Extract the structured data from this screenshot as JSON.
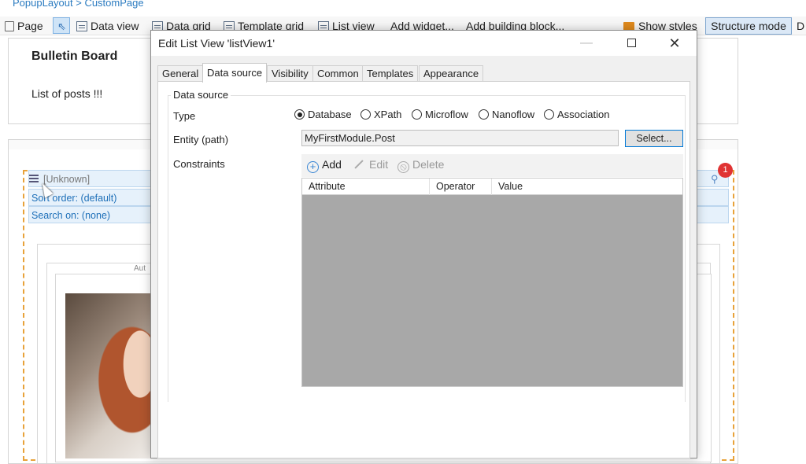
{
  "breadcrumb": {
    "text": "PopupLayout  >  CustomPage"
  },
  "toolbar": {
    "page": "Page",
    "data_view": "Data view",
    "data_grid": "Data grid",
    "template_grid": "Template grid",
    "list_view": "List view",
    "add_widget": "Add widget...",
    "add_building_block": "Add building block...",
    "show_styles": "Show styles",
    "structure_mode": "Structure mode",
    "overflow": "D"
  },
  "canvas": {
    "bulletin_title": "Bulletin Board",
    "list_of_posts": "List of posts !!!",
    "listview_unknown": "[Unknown]",
    "sort_order": "Sort order: (default)",
    "search_on": "Search on: (none)",
    "auto_label": "Aut",
    "badge_count": "1"
  },
  "dialog": {
    "title": "Edit List View 'listView1'",
    "tabs": [
      "General",
      "Data source",
      "Visibility",
      "Common",
      "Templates",
      "Appearance"
    ],
    "active_tab": "Data source",
    "group_label": "Data source",
    "type_label": "Type",
    "type_options": [
      "Database",
      "XPath",
      "Microflow",
      "Nanoflow",
      "Association"
    ],
    "type_selected": "Database",
    "entity_label": "Entity (path)",
    "entity_value": "MyFirstModule.Post",
    "select_button": "Select...",
    "constraints_label": "Constraints",
    "constraint_actions": {
      "add": "Add",
      "edit": "Edit",
      "delete": "Delete"
    },
    "columns": [
      "Attribute",
      "Operator",
      "Value"
    ]
  },
  "colors": {
    "accent": "#2b7bc0",
    "selection_border": "#e8a23a",
    "badge": "#e03333",
    "table_empty": "#a8a8a8"
  }
}
